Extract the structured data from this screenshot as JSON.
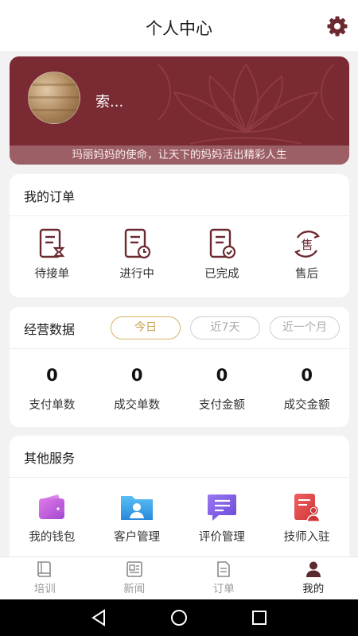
{
  "header": {
    "title": "个人中心",
    "settings_icon": "gear-icon"
  },
  "profile": {
    "name": "索...",
    "slogan": "玛丽妈妈的使命，让天下的妈妈活出精彩人生",
    "bg_color": "#7a2a32"
  },
  "orders": {
    "title": "我的订单",
    "items": [
      {
        "label": "待接单",
        "icon": "hourglass-list-icon"
      },
      {
        "label": "进行中",
        "icon": "clock-list-icon"
      },
      {
        "label": "已完成",
        "icon": "check-list-icon"
      },
      {
        "label": "售后",
        "icon": "after-sale-icon"
      }
    ]
  },
  "business": {
    "title": "经营数据",
    "filters": [
      "今日",
      "近7天",
      "近一个月"
    ],
    "active_filter": "今日",
    "stats": [
      {
        "value": "0",
        "label": "支付单数"
      },
      {
        "value": "0",
        "label": "成交单数"
      },
      {
        "value": "0",
        "label": "支付金额"
      },
      {
        "value": "0",
        "label": "成交金额"
      }
    ]
  },
  "services": {
    "title": "其他服务",
    "items": [
      {
        "label": "我的钱包",
        "icon": "wallet-icon",
        "color": "#c060d8"
      },
      {
        "label": "客户管理",
        "icon": "customer-folder-icon",
        "color": "#3aa4e8"
      },
      {
        "label": "评价管理",
        "icon": "comment-icon",
        "color": "#7a58e0"
      },
      {
        "label": "技师入驻",
        "icon": "technician-icon",
        "color": "#e04848"
      }
    ]
  },
  "tabbar": {
    "items": [
      {
        "label": "培训",
        "icon": "book-icon"
      },
      {
        "label": "新闻",
        "icon": "news-icon"
      },
      {
        "label": "订单",
        "icon": "document-icon"
      },
      {
        "label": "我的",
        "icon": "user-icon"
      }
    ],
    "active": "我的"
  },
  "accent_color": "#6b2a30",
  "android_nav": {
    "icons": [
      "back-icon",
      "home-icon",
      "recents-icon"
    ]
  }
}
